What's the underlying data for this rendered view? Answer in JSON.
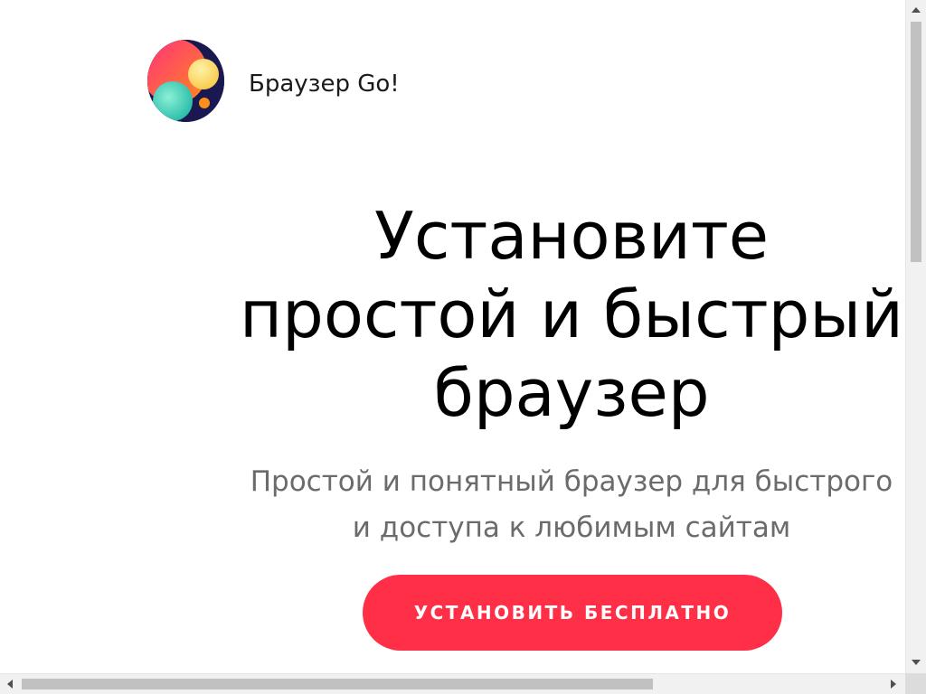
{
  "header": {
    "brand_name": "Браузер Go!",
    "logo_icon": "browser-go-logo-icon"
  },
  "hero": {
    "title_lines": [
      "Установите",
      "простой и быстрый",
      "браузер"
    ],
    "subtitle_lines": [
      "Простой и понятный браузер для быстрого",
      "и доступа к любимым сайтам"
    ],
    "cta_label": "УСТАНОВИТЬ БЕСПЛАТНО"
  },
  "colors": {
    "cta_background": "#fe2f46",
    "cta_text": "#ffffff",
    "title_text": "#000000",
    "subtitle_text": "#6b6b6b"
  },
  "scrollbars": {
    "vertical_position": 0,
    "horizontal_position": 0
  }
}
